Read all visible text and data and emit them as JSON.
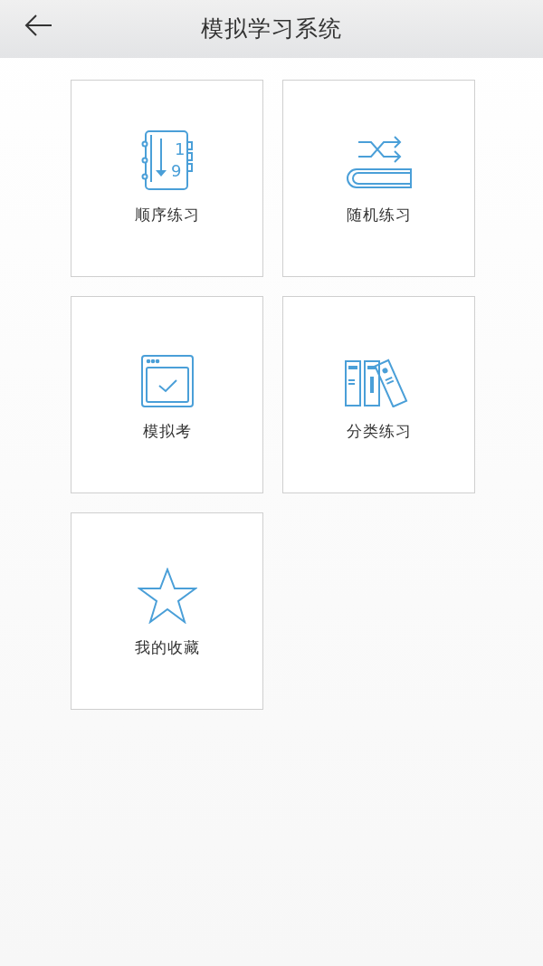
{
  "header": {
    "title": "模拟学习系统"
  },
  "tiles": [
    {
      "kind": "order",
      "label": "顺序练习",
      "icon_digits": [
        "1",
        "9"
      ]
    },
    {
      "kind": "random",
      "label": "随机练习"
    },
    {
      "kind": "exam",
      "label": "模拟考"
    },
    {
      "kind": "category",
      "label": "分类练习"
    },
    {
      "kind": "favorite",
      "label": "我的收藏"
    }
  ]
}
